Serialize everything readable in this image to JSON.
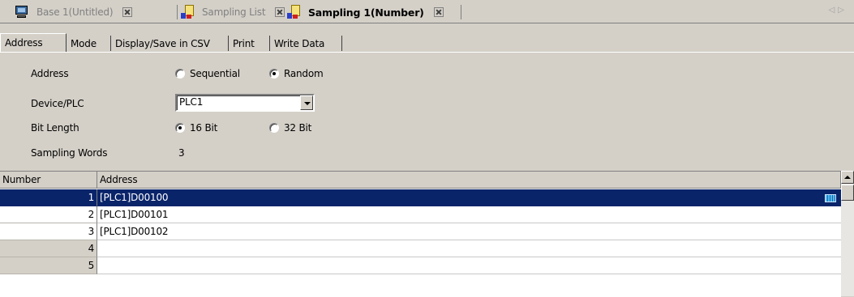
{
  "doc_tabs": [
    {
      "label": "Base 1(Untitled)",
      "icon": "monitor-icon",
      "active": false
    },
    {
      "label": "Sampling List",
      "icon": "sampling-icon",
      "active": false
    },
    {
      "label": "Sampling 1(Number)",
      "icon": "sampling-icon",
      "active": true
    }
  ],
  "property_tabs": [
    {
      "label": "Address",
      "active": true
    },
    {
      "label": "Mode",
      "active": false
    },
    {
      "label": "Display/Save in CSV",
      "active": false
    },
    {
      "label": "Print",
      "active": false
    },
    {
      "label": "Write Data",
      "active": false
    }
  ],
  "form": {
    "address": {
      "label": "Address",
      "options": [
        "Sequential",
        "Random"
      ],
      "selected": "Random"
    },
    "device": {
      "label": "Device/PLC",
      "value": "PLC1"
    },
    "bit_length": {
      "label": "Bit Length",
      "options": [
        "16 Bit",
        "32 Bit"
      ],
      "selected": "16 Bit"
    },
    "sampling_words": {
      "label": "Sampling Words",
      "value": "3"
    }
  },
  "grid": {
    "columns": [
      "Number",
      "Address"
    ],
    "rows": [
      {
        "number": "1",
        "address": "[PLC1]D00100",
        "selected": true
      },
      {
        "number": "2",
        "address": "[PLC1]D00101",
        "selected": false
      },
      {
        "number": "3",
        "address": "[PLC1]D00102",
        "selected": false
      },
      {
        "number": "4",
        "address": "",
        "selected": false
      },
      {
        "number": "5",
        "address": "",
        "selected": false
      }
    ]
  },
  "colors": {
    "selection": "#0a246a",
    "face": "#d4d0c8"
  }
}
